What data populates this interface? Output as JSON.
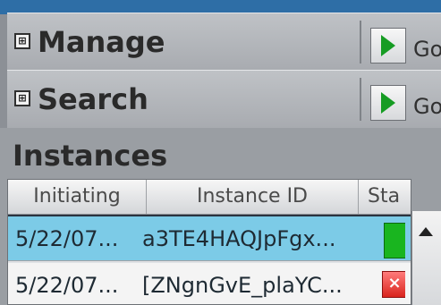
{
  "panels": [
    {
      "label": "Manage",
      "expander": "⊞",
      "go_label": "Go"
    },
    {
      "label": "Search",
      "expander": "⊞",
      "go_label": "Go"
    }
  ],
  "instances": {
    "title": "Instances",
    "columns": [
      "Initiating",
      "Instance ID",
      "Sta"
    ],
    "rows": [
      {
        "initiating": "5/22/07...",
        "instance_id": "a3TE4HAQJpFgx...",
        "status": "running",
        "selected": true
      },
      {
        "initiating": "5/22/07...",
        "instance_id": "[ZNgnGvE_plaYC...",
        "status": "error",
        "selected": false
      }
    ]
  },
  "icons": {
    "go": "play-arrow-icon",
    "expand": "expand-icon",
    "status_ok": "status-running-icon",
    "status_error": "status-error-icon",
    "scroll_up": "scroll-up-icon"
  },
  "colors": {
    "selection": "#7ccbe7",
    "go_arrow": "#169c23",
    "status_ok": "#19b51f",
    "status_error": "#d9241d"
  }
}
